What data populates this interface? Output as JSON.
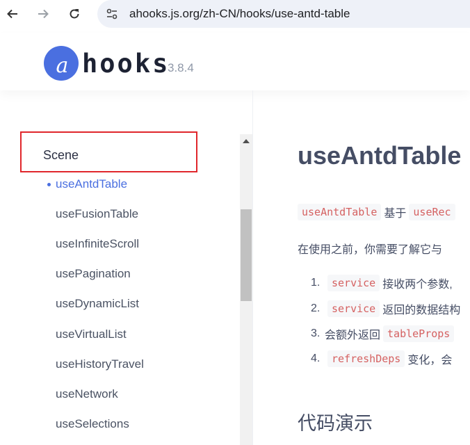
{
  "browser": {
    "url": "ahooks.js.org/zh-CN/hooks/use-antd-table"
  },
  "header": {
    "logo_letter": "a",
    "logo_text": "hooks",
    "version": "3.8.4",
    "brand_color": "#4a6fe0"
  },
  "sidebar": {
    "group_title": "Scene",
    "items": [
      {
        "label": "useAntdTable",
        "active": true
      },
      {
        "label": "useFusionTable"
      },
      {
        "label": "useInfiniteScroll"
      },
      {
        "label": "usePagination"
      },
      {
        "label": "useDynamicList"
      },
      {
        "label": "useVirtualList"
      },
      {
        "label": "useHistoryTravel"
      },
      {
        "label": "useNetwork"
      },
      {
        "label": "useSelections"
      }
    ],
    "highlight_color": "#e0262b"
  },
  "main": {
    "title": "useAntdTable",
    "intro": {
      "code1": "useAntdTable",
      "text1": "基于",
      "code2": "useRec"
    },
    "before_use": "在使用之前，你需要了解它与",
    "list": [
      {
        "num": "1.",
        "code": "service",
        "text": "接收两个参数,"
      },
      {
        "num": "2.",
        "code": "service",
        "text": "返回的数据结构"
      },
      {
        "num": "3.",
        "prefix": "会额外返回",
        "code": "tableProps"
      },
      {
        "num": "4.",
        "code": "refreshDeps",
        "text": "变化，会"
      }
    ],
    "section_title": "代码演示"
  }
}
